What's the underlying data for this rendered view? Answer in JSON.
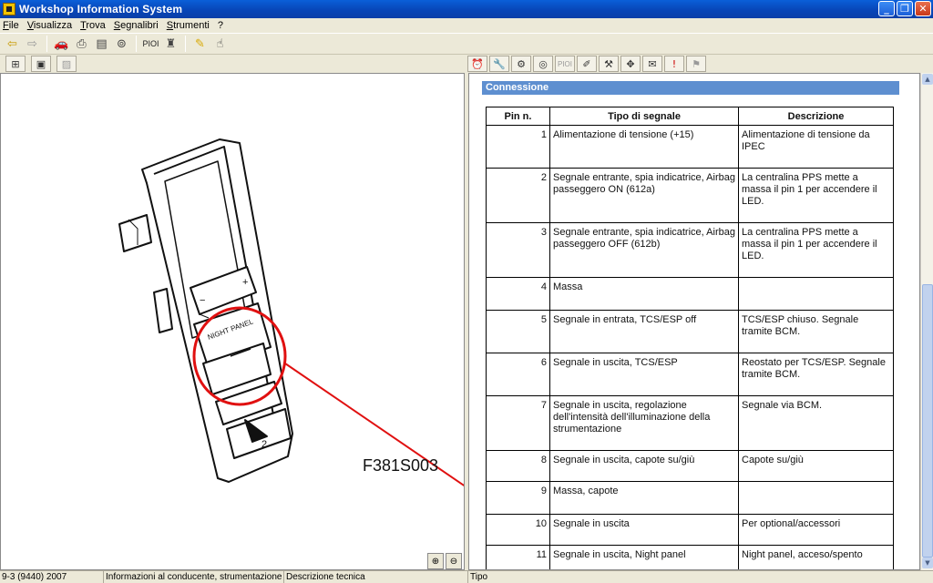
{
  "window": {
    "title": "Workshop Information System"
  },
  "menu": [
    "File",
    "Visualizza",
    "Trova",
    "Segnalibri",
    "Strumenti",
    "?"
  ],
  "toolbar": {
    "pioi_label": "PIOI",
    "right_pioi_label": "PIOI"
  },
  "figure": {
    "label": "F381S003"
  },
  "content": {
    "section_title": "Connessione",
    "table": {
      "headers": [
        "Pin n.",
        "Tipo di segnale",
        "Descrizione"
      ],
      "rows": [
        [
          "1",
          "Alimentazione di tensione (+15)",
          "Alimentazione di tensione da IPEC"
        ],
        [
          "2",
          "Segnale entrante, spia indicatrice, Airbag passeggero ON (612a)",
          "La centralina PPS mette a massa il pin 1 per accendere il LED."
        ],
        [
          "3",
          "Segnale entrante, spia indicatrice, Airbag passeggero OFF (612b)",
          "La centralina PPS mette a massa il pin 1 per accendere il LED."
        ],
        [
          "4",
          "Massa",
          ""
        ],
        [
          "5",
          "Segnale in entrata, TCS/ESP off",
          "TCS/ESP chiuso. Segnale tramite BCM."
        ],
        [
          "6",
          "Segnale in uscita, TCS/ESP",
          "Reostato per TCS/ESP. Segnale tramite BCM."
        ],
        [
          "7",
          "Segnale in uscita, regolazione dell'intensità dell'illuminazione della strumentazione",
          "Segnale via BCM."
        ],
        [
          "8",
          "Segnale in uscita, capote su/giù",
          "Capote su/giù"
        ],
        [
          "9",
          "Massa, capote",
          ""
        ],
        [
          "10",
          "Segnale in uscita",
          "Per optional/accessori"
        ],
        [
          "11",
          "Segnale in uscita, Night panel",
          "Night panel, acceso/spento"
        ]
      ]
    }
  },
  "status": {
    "vehicle": "9-3 (9440) 2007",
    "section": "Informazioni al conducente, strumentazione",
    "doc_type": "Descrizione tecnica",
    "tipo": "Tipo"
  },
  "colors": {
    "accent": "#5e8fd0",
    "callout": "#e01010",
    "titlebar": "#0a5fd8"
  },
  "icons": [
    "back-arrow-icon",
    "forward-arrow-icon",
    "car-icon",
    "printer-icon",
    "document-export-icon",
    "binoculars-icon",
    "flashlight-icon",
    "pencil-icon",
    "pointer-icon",
    "zoom-in-icon",
    "zoom-out-icon"
  ]
}
